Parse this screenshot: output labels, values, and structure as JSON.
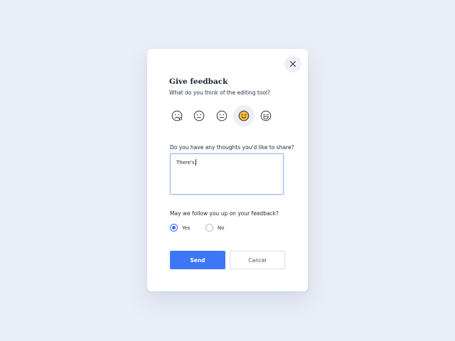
{
  "dialog": {
    "title": "Give feedback",
    "subtitle": "What do you think of the editing tool?",
    "ratings": [
      {
        "icon": "crying-face-icon",
        "selected": false
      },
      {
        "icon": "sad-face-icon",
        "selected": false
      },
      {
        "icon": "neutral-face-icon",
        "selected": false
      },
      {
        "icon": "smiling-face-icon",
        "selected": true
      },
      {
        "icon": "laughing-face-icon",
        "selected": false
      }
    ],
    "thoughts_label": "Do you have any thoughts you'd like to share?",
    "thoughts_value": "There's",
    "followup_label": "May we follow you up on your feedback?",
    "options": [
      {
        "label": "Yes",
        "checked": true
      },
      {
        "label": "No",
        "checked": false
      }
    ],
    "send_label": "Send",
    "cancel_label": "Cancel"
  },
  "colors": {
    "accent": "#3d76f7",
    "selected_emoji": "#f5b93e",
    "background": "#eaeef6"
  }
}
